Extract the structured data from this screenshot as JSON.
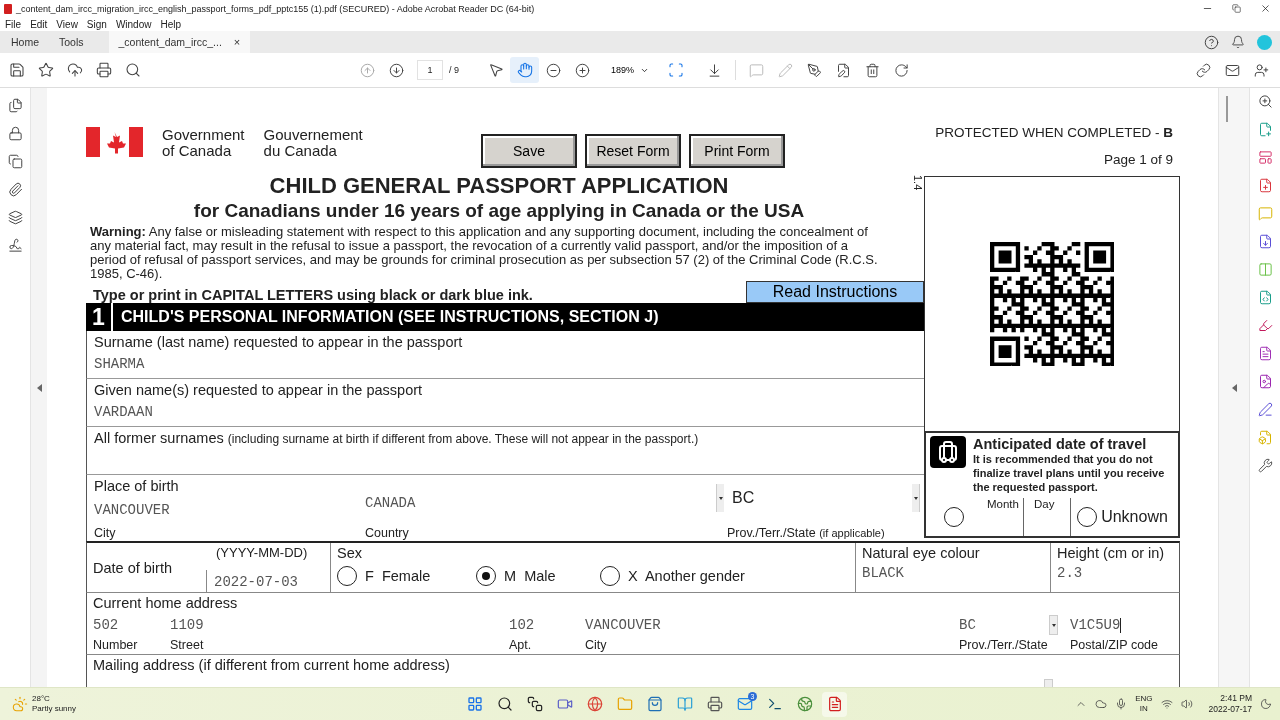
{
  "window": {
    "title": "_content_dam_ircc_migration_ircc_english_passport_forms_pdf_pptc155 (1).pdf (SECURED) - Adobe Acrobat Reader DC (64-bit)"
  },
  "menu": [
    "File",
    "Edit",
    "View",
    "Sign",
    "Window",
    "Help"
  ],
  "tabs": [
    {
      "label": "Home",
      "selected": false
    },
    {
      "label": "Tools",
      "selected": false
    },
    {
      "label": "_content_dam_ircc_...",
      "selected": true,
      "close": "×"
    }
  ],
  "toolbar": {
    "page": "1",
    "page_count": "/ 9",
    "zoom": "189%",
    "tools": [
      {
        "kind": "select",
        "selected": false
      },
      {
        "kind": "hand",
        "selected": true
      }
    ]
  },
  "form": {
    "gov_en": [
      "Government",
      "of Canada"
    ],
    "gov_fr": [
      "Gouvernement",
      "du Canada"
    ],
    "buttons": [
      "Save",
      "Reset Form",
      "Print Form"
    ],
    "protected": "PROTECTED WHEN COMPLETED - **B**",
    "page_label": "Page 1 of 9",
    "title": "CHILD GENERAL PASSPORT APPLICATION",
    "subtitle": "for Canadians under 16 years of age applying in Canada or the USA",
    "version": "1.4",
    "warning": "**Warning:** Any false or misleading statement with respect to this application and any supporting document, including the concealment of any material fact, may result in the refusal to issue a passport, the revocation of a currently valid passport, and/or the imposition of a period of refusal of passport services, and may be grounds for criminal prosecution as per subsection 57 (2) of the Criminal Code (R.C.S. 1985, C-46).",
    "instruction": "Type or print in CAPITAL LETTERS using black or dark blue ink.",
    "read_button": "Read Instructions",
    "section": {
      "number": "1",
      "title": "CHILD'S PERSONAL INFORMATION (SEE INSTRUCTIONS, SECTION J)"
    },
    "surname": {
      "label": "Surname (last name) requested to appear in the passport",
      "value": "SHARMA"
    },
    "given": {
      "label": "Given name(s) requested to appear in the passport",
      "value": "VARDAAN"
    },
    "former": {
      "label": "All former surnames",
      "note": "(including surname at birth if different from above. These will not appear in the passport.)"
    },
    "birth_place": {
      "label": "Place of birth",
      "city": "VANCOUVER",
      "city_label": "City",
      "country": "CANADA",
      "country_label": "Country",
      "province": "BC",
      "province_label": "Prov./Terr./State",
      "province_note": "(if applicable)"
    },
    "travel": {
      "title": "Anticipated date of travel",
      "note": "It is recommended that you do not finalize travel plans until you receive the requested passport.",
      "date_selected": false,
      "month_label": "Month",
      "day_label": "Day",
      "unknown_label": "Unknown",
      "unknown_selected": false
    },
    "dob": {
      "label": "Date of birth",
      "format": "(YYYY-MM-DD)",
      "value": "2022-07-03"
    },
    "sex": {
      "label": "Sex",
      "options": [
        {
          "code": "F",
          "label": "Female",
          "selected": false
        },
        {
          "code": "M",
          "label": "Male",
          "selected": true
        },
        {
          "code": "X",
          "label": "Another gender",
          "selected": false
        }
      ]
    },
    "eye": {
      "label": "Natural eye colour",
      "value": "BLACK"
    },
    "height": {
      "label": "Height (cm or in)",
      "value": "2.3"
    },
    "address": {
      "label": "Current home address",
      "number": "502",
      "street": "1109",
      "apt": "102",
      "city": "VANCOUVER",
      "province": "BC",
      "postal": "V1C5U9",
      "number_label": "Number",
      "street_label": "Street",
      "apt_label": "Apt.",
      "city_label": "City",
      "province_label": "Prov./Terr./State",
      "postal_label": "Postal/ZIP code"
    },
    "mailing": {
      "label": "Mailing address (if different from current home address)"
    }
  },
  "taskbar": {
    "temp": "28°C",
    "weather": "Partly sunny",
    "mail_badge": "3",
    "lang": "ENG",
    "region": "IN",
    "time": "2:41 PM",
    "date": "2022-07-17"
  }
}
